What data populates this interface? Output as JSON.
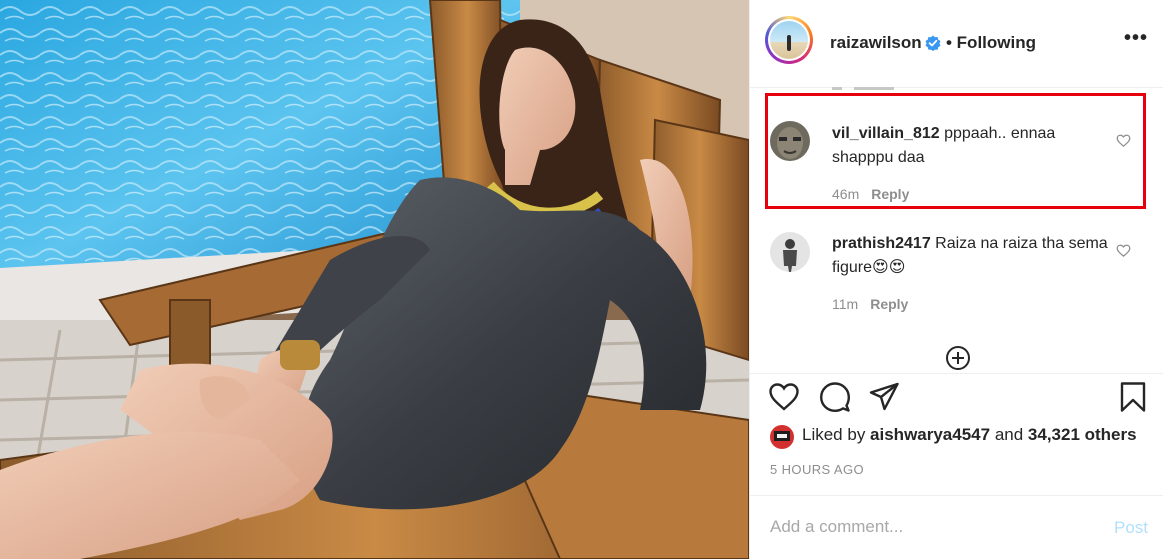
{
  "header": {
    "username": "raizawilson",
    "following_label": "• Following",
    "more_label": "•••",
    "icons": [
      "verified-badge-icon",
      "more-options-icon"
    ]
  },
  "comments": [
    {
      "username": "vil_villain_812",
      "text": "pppaah.. ennaa shapppu daa",
      "time": "46m",
      "reply_label": "Reply",
      "highlighted": true
    },
    {
      "username": "prathish2417",
      "text": "Raiza na raiza tha sema figure",
      "emoji": "😍😍",
      "time": "11m",
      "reply_label": "Reply"
    }
  ],
  "actions": {
    "icons": [
      "heart-icon",
      "comment-icon",
      "share-icon",
      "bookmark-icon"
    ]
  },
  "likes": {
    "prefix": "Liked by ",
    "user": "aishwarya4547",
    "middle": " and ",
    "count_text": "34,321 others"
  },
  "timestamp": "5 HOURS AGO",
  "add_comment": {
    "placeholder": "Add a comment...",
    "post_label": "Post"
  },
  "colors": {
    "highlight_border": "#e5000b",
    "verified_blue": "#3897f0",
    "post_disabled": "#b2dffc",
    "muted_text": "#8e8e8e"
  }
}
